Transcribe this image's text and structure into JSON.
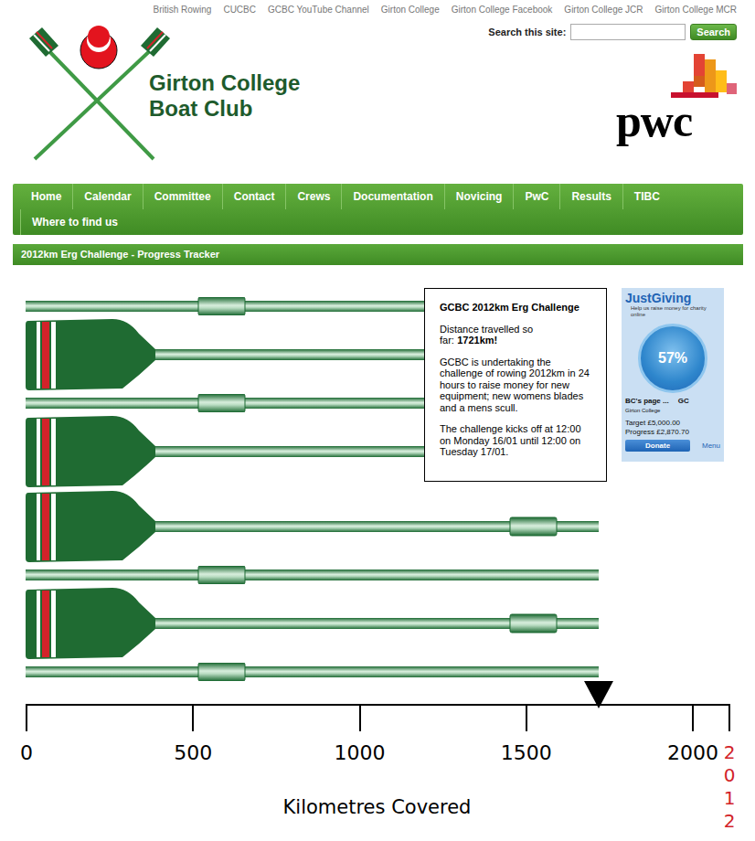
{
  "top_links": [
    "British Rowing",
    "CUCBC",
    "GCBC YouTube Channel",
    "Girton College",
    "Girton College Facebook",
    "Girton College JCR",
    "Girton College MCR"
  ],
  "site": {
    "title_line1": "Girton College",
    "title_line2": "Boat Club"
  },
  "search": {
    "label": "Search this site:",
    "button": "Search"
  },
  "sponsor": {
    "logo_text": "pwc"
  },
  "nav": [
    "Home",
    "Calendar",
    "Committee",
    "Contact",
    "Crews",
    "Documentation",
    "Novicing",
    "PwC",
    "Results",
    "TIBC",
    "Where to find us"
  ],
  "section_title": "2012km Erg Challenge - Progress Tracker",
  "info_box": {
    "title": "GCBC 2012km Erg Challenge",
    "distance_label": "Distance travelled so far:",
    "distance_value": "1721km!",
    "paragraphs": [
      "GCBC is undertaking the challenge of rowing 2012km in 24 hours to raise money for new equipment; new womens blades and a mens scull.",
      "The challenge kicks off at 12:00 on Monday 16/01 until 12:00 on Tuesday 17/01."
    ]
  },
  "justgiving": {
    "logo": "JustGiving",
    "tagline": "Help us raise money for charity online",
    "percent": "57%",
    "page_name": "BC's page ...",
    "page_suffix": "GC",
    "org": "Girton College",
    "target": "Target £5,000.00",
    "progress": "Progress £2,870.70",
    "donate": "Donate",
    "menu": "Menu"
  },
  "chart": {
    "ticks": [
      "0",
      "500",
      "1000",
      "1500",
      "2000"
    ],
    "end_label": "2012",
    "axis_title": "Kilometres Covered",
    "values": [
      1721
    ]
  },
  "oars": [
    {
      "kind": "shaft"
    },
    {
      "kind": "blade"
    },
    {
      "kind": "shaft"
    },
    {
      "kind": "blade"
    },
    {
      "kind": "blade"
    },
    {
      "kind": "shaft"
    },
    {
      "kind": "blade"
    },
    {
      "kind": "shaft"
    }
  ]
}
